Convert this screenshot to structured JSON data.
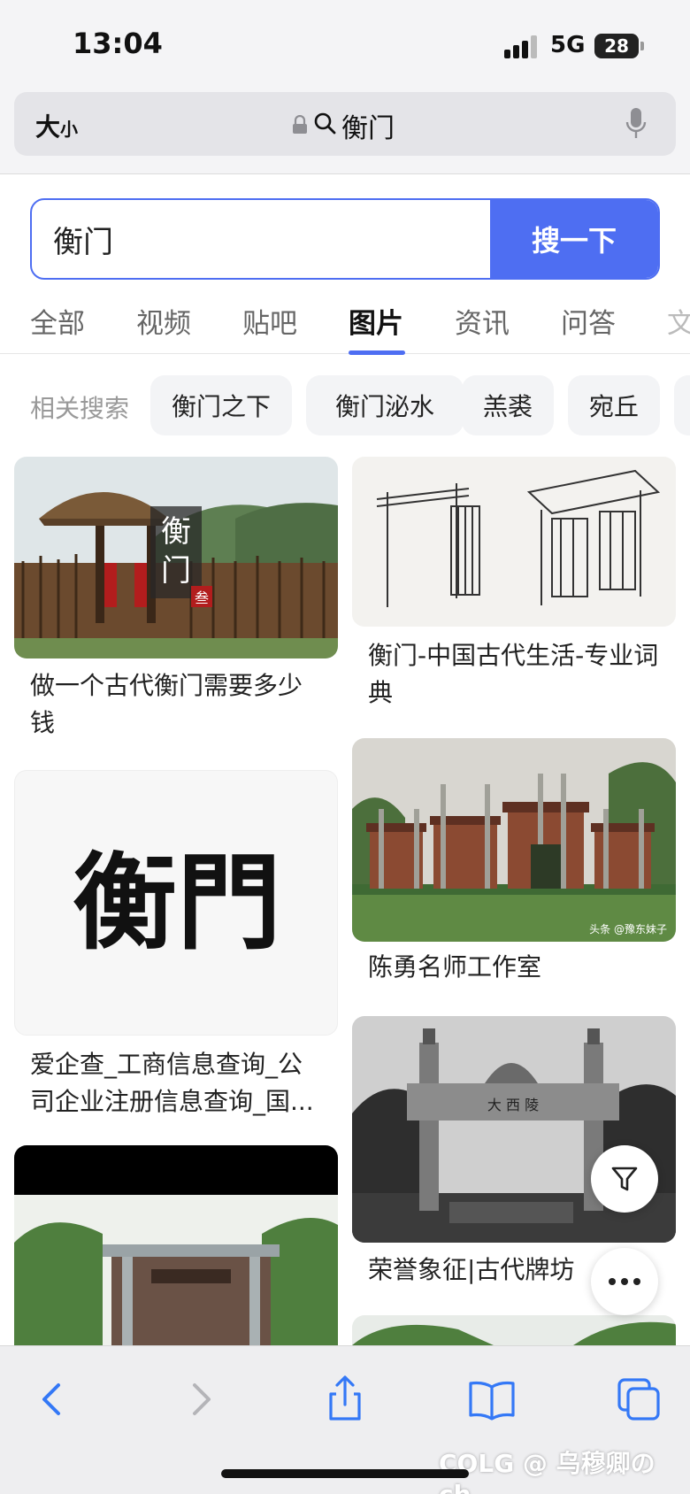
{
  "status_bar": {
    "time": "13:04",
    "network": "5G",
    "battery": "28"
  },
  "browser": {
    "text_size_big": "大",
    "text_size_small": "小",
    "address": "衡门"
  },
  "search": {
    "query": "衡门",
    "button_label": "搜一下"
  },
  "tabs": [
    {
      "label": "全部",
      "active": false
    },
    {
      "label": "视频",
      "active": false
    },
    {
      "label": "贴吧",
      "active": false
    },
    {
      "label": "图片",
      "active": true
    },
    {
      "label": "资讯",
      "active": false
    },
    {
      "label": "问答",
      "active": false
    },
    {
      "label": "文",
      "active": false
    }
  ],
  "related": {
    "label": "相关搜索",
    "chips": [
      "衡门之下",
      "衡门泌水",
      "羔裘",
      "宛丘"
    ]
  },
  "results": {
    "left": [
      {
        "title": "做一个古代衡门需要多少钱",
        "line1": "做一个古代衡门需要多少",
        "line2": "钱",
        "overlay_text": "衡门",
        "seal_text": "叁"
      },
      {
        "title": "爱企查_工商信息查询_公司企业注册信息查询_国...",
        "line1": "爱企查_工商信息查询_公",
        "line2": "司企业注册信息查询_国...",
        "calligraphy": "衡門"
      },
      {
        "title": ""
      }
    ],
    "right": [
      {
        "title": "衡门-中国古代生活-专业词典",
        "line1": "衡门-中国古代生活-专业词",
        "line2": "典"
      },
      {
        "title": "陈勇名师工作室",
        "line1": "陈勇名师工作室",
        "line2": "",
        "image_credit": "头条 @豫东妹子"
      },
      {
        "title": "荣誉象征|古代牌坊",
        "line1": "荣誉象征|古代牌坊",
        "line2": "",
        "plaque_text": "大 西 陵"
      }
    ]
  },
  "floating": {
    "filter_icon": "filter-icon",
    "more_icon": "more-icon"
  },
  "toolbar": {
    "icons": [
      "back-icon",
      "forward-icon",
      "share-icon",
      "bookmarks-icon",
      "tabs-icon"
    ]
  },
  "watermark": "COLG @ 乌穆卿の ch",
  "colors": {
    "accent": "#4e6ef2",
    "chip_bg": "#f3f4f6",
    "toolbar_icon": "#3478f6"
  }
}
